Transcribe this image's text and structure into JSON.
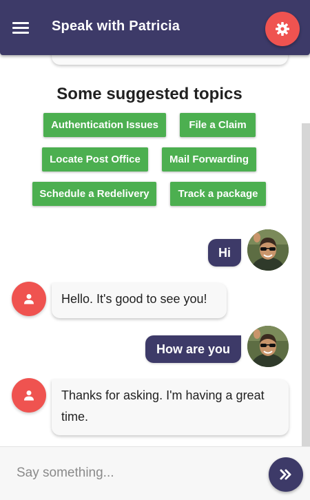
{
  "header": {
    "title": "Speak with Patricia",
    "menu_icon": "menu-icon",
    "settings_icon": "settings-gear-icon",
    "accent_color": "#3d3a68",
    "fab_color": "#ef5350"
  },
  "topics": {
    "heading": "Some suggested topics",
    "items": [
      "Authentication Issues",
      "File a Claim",
      "Locate Post Office",
      "Mail Forwarding",
      "Schedule a Redelivery",
      "Track a package"
    ],
    "color": "#4caf50"
  },
  "messages": [
    {
      "sender": "user",
      "text": "Hi"
    },
    {
      "sender": "bot",
      "text": "Hello. It's good to see you!"
    },
    {
      "sender": "user",
      "text": "How are you"
    },
    {
      "sender": "bot",
      "text": "Thanks for asking. I'm having a great time."
    }
  ],
  "input": {
    "placeholder": "Say something...",
    "value": "",
    "send_icon": "double-chevron-right-icon"
  }
}
